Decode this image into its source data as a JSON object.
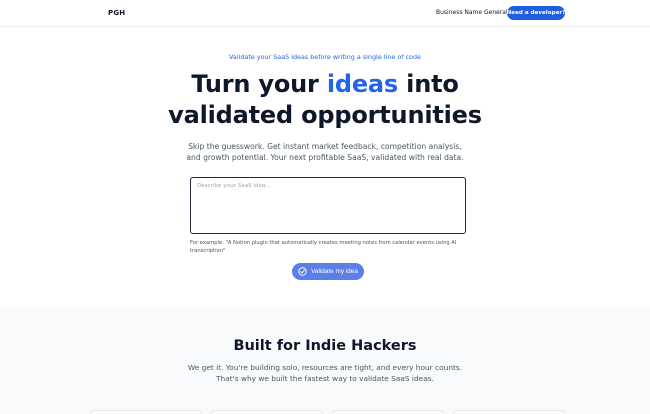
{
  "header": {
    "logo": "PGH",
    "nav_link": "Business Name Generator",
    "cta": "Need a developer?"
  },
  "hero": {
    "eyebrow": "Validate your SaaS ideas before writing a single line of code",
    "title_before": "Turn your ",
    "title_accent": "ideas",
    "title_after": " into",
    "title_line2": "validated opportunities",
    "subtitle_line1": "Skip the guesswork. Get instant market feedback, competition analysis,",
    "subtitle_line2": "and growth potential. Your next profitable SaaS, validated with real data.",
    "input_placeholder": "Describe your SaaS idea...",
    "example": "For example: \"A Notion plugin that automatically creates meeting notes from calendar events using AI transcription\"",
    "button_label": "Validate my idea"
  },
  "indie": {
    "title": "Built for Indie Hackers",
    "subtitle_line1": "We get it. You're building solo, resources are tight, and every hour counts.",
    "subtitle_line2": "That's why we built the fastest way to validate SaaS ideas."
  },
  "colors": {
    "accent": "#2563eb",
    "cta_dark": "#1f5fe0",
    "button": "#5b7fe6"
  }
}
